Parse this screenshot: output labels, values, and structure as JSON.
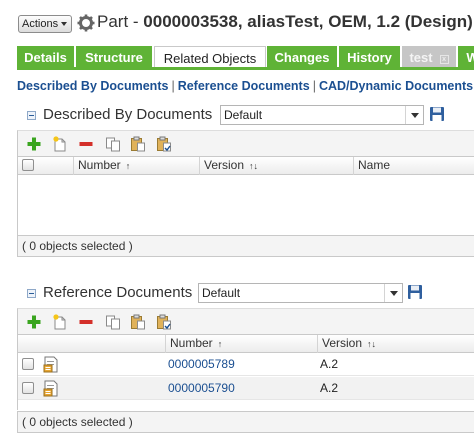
{
  "header": {
    "actions_label": "Actions",
    "title_prefix": "Part - ",
    "title_bold": "0000003538, aliasTest, OEM, 1.2 (Design)"
  },
  "tabs": [
    {
      "label": "Details",
      "state": "normal"
    },
    {
      "label": "Structure",
      "state": "normal"
    },
    {
      "label": "Related Objects",
      "state": "active"
    },
    {
      "label": "Changes",
      "state": "normal"
    },
    {
      "label": "History",
      "state": "normal"
    },
    {
      "label": "test",
      "state": "disabled"
    },
    {
      "label": "W",
      "state": "normal"
    }
  ],
  "subnav": {
    "items": [
      "Described By Documents",
      "Reference Documents",
      "CAD/Dynamic Documents"
    ],
    "separator": "|"
  },
  "described": {
    "title": "Described By Documents",
    "view": "Default",
    "columns": {
      "number": "Number",
      "version": "Version",
      "name": "Name"
    },
    "sort_number": "↑",
    "sort_version": "↑↓",
    "status": "( 0 objects selected )"
  },
  "reference": {
    "title": "Reference Documents",
    "view": "Default",
    "columns": {
      "number": "Number",
      "version": "Version"
    },
    "sort_number": "↑",
    "sort_version": "↑↓",
    "rows": [
      {
        "number": "0000005789",
        "version": "A.2"
      },
      {
        "number": "0000005790",
        "version": "A.2"
      }
    ],
    "status": "( 0 objects selected )"
  },
  "icons": {
    "actions_caret": "chevron-down-icon",
    "part": "gear-icon",
    "add": "plus-icon",
    "new": "new-document-icon",
    "remove": "minus-icon",
    "copy": "copy-icon",
    "paste": "paste-icon",
    "paste_special": "paste-special-icon",
    "save": "save-icon",
    "document": "document-icon"
  },
  "colors": {
    "tab_green": "#5fb336",
    "tab_disabled": "#c6c6c6",
    "link_blue": "#1b4f91",
    "add_green": "#3aa51f",
    "remove_red": "#d4302a"
  }
}
